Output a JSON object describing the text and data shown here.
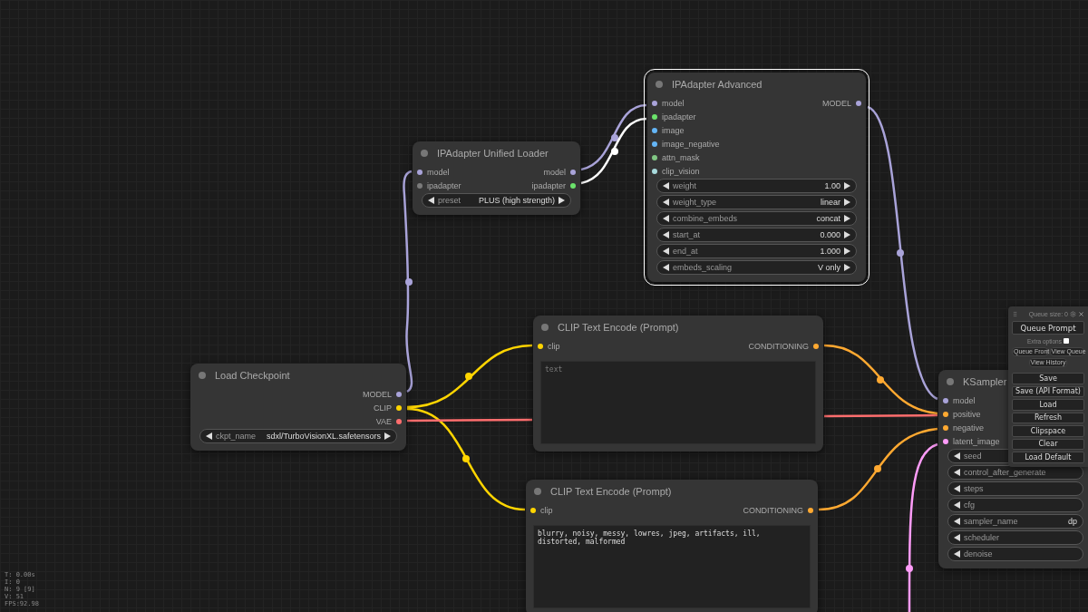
{
  "nodes": [
    {
      "title": "IPAdapter Unified Loader",
      "selected": false,
      "inputs": [
        {
          "label": "model",
          "color": "#a9a3d9"
        },
        {
          "label": "ipadapter",
          "color": "#7a7a7a"
        }
      ],
      "outputs": [
        {
          "label": "model",
          "color": "#a9a3d9"
        },
        {
          "label": "ipadapter",
          "color": "#6be36b"
        }
      ],
      "widgets": [
        {
          "label": "preset",
          "value": "PLUS (high strength)"
        }
      ]
    },
    {
      "title": "IPAdapter Advanced",
      "selected": true,
      "inputs": [
        {
          "label": "model",
          "color": "#a9a3d9"
        },
        {
          "label": "ipadapter",
          "color": "#6be36b"
        },
        {
          "label": "image",
          "color": "#64b5f6"
        },
        {
          "label": "image_negative",
          "color": "#64b5f6"
        },
        {
          "label": "attn_mask",
          "color": "#81c784"
        },
        {
          "label": "clip_vision",
          "color": "#a8dadc"
        }
      ],
      "outputs": [
        {
          "label": "MODEL",
          "color": "#a9a3d9"
        }
      ],
      "widgets": [
        {
          "label": "weight",
          "value": "1.00"
        },
        {
          "label": "weight_type",
          "value": "linear"
        },
        {
          "label": "combine_embeds",
          "value": "concat"
        },
        {
          "label": "start_at",
          "value": "0.000"
        },
        {
          "label": "end_at",
          "value": "1.000"
        },
        {
          "label": "embeds_scaling",
          "value": "V only"
        }
      ]
    },
    {
      "title": "Load Checkpoint",
      "selected": false,
      "outputs": [
        {
          "label": "MODEL",
          "color": "#a9a3d9"
        },
        {
          "label": "CLIP",
          "color": "#ffd500"
        },
        {
          "label": "VAE",
          "color": "#ff6e6e"
        }
      ],
      "widgets": [
        {
          "label": "ckpt_name",
          "value": "sdxl/TurboVisionXL.safetensors"
        }
      ]
    },
    {
      "title": "CLIP Text Encode (Prompt)",
      "selected": false,
      "inputs": [
        {
          "label": "clip",
          "color": "#ffd500"
        }
      ],
      "outputs": [
        {
          "label": "CONDITIONING",
          "color": "#ffa931"
        }
      ],
      "textarea": {
        "placeholder": "text"
      }
    },
    {
      "title": "CLIP Text Encode (Prompt)",
      "selected": false,
      "inputs": [
        {
          "label": "clip",
          "color": "#ffd500"
        }
      ],
      "outputs": [
        {
          "label": "CONDITIONING",
          "color": "#ffa931"
        }
      ],
      "textarea": {
        "value": "blurry, noisy, messy, lowres, jpeg, artifacts, ill, distorted, malformed"
      }
    },
    {
      "title": "KSampler",
      "selected": false,
      "clipped": true,
      "inputs": [
        {
          "label": "model",
          "color": "#a9a3d9"
        },
        {
          "label": "positive",
          "color": "#ffa931"
        },
        {
          "label": "negative",
          "color": "#ffa931"
        },
        {
          "label": "latent_image",
          "color": "#ff9cf9"
        }
      ],
      "widgets": [
        {
          "label": "seed"
        },
        {
          "label": "control_after_generate"
        },
        {
          "label": "steps"
        },
        {
          "label": "cfg"
        },
        {
          "label": "sampler_name",
          "value": "dp"
        },
        {
          "label": "scheduler"
        },
        {
          "label": "denoise"
        }
      ]
    }
  ],
  "menu": {
    "queue_size": "Queue size: 0",
    "queue_button": "Queue Prompt",
    "extra_options": {
      "label": "Extra options",
      "checked": false
    },
    "small_buttons": [
      "Queue Front",
      "View Queue",
      "View History"
    ],
    "buttons": [
      "Save",
      "Save (API Format)",
      "Load",
      "Refresh",
      "Clipspace",
      "Clear",
      "Load Default"
    ]
  },
  "stats": [
    "T: 0.00s",
    "I: 0",
    "N: 9 [9]",
    "V: 51",
    "FPS:92.98"
  ]
}
